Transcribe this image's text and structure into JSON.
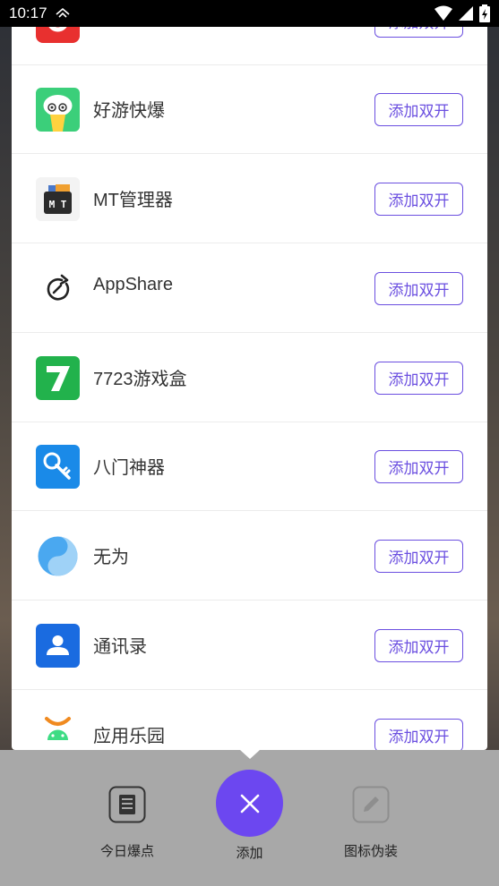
{
  "status_bar": {
    "time": "10:17"
  },
  "apps": [
    {
      "name": "",
      "button": "添加双开",
      "icon": "red-app-icon"
    },
    {
      "name": "好游快爆",
      "button": "添加双开",
      "icon": "haoyou-icon"
    },
    {
      "name": "MT管理器",
      "button": "添加双开",
      "icon": "mt-manager-icon"
    },
    {
      "name": "AppShare",
      "button": "添加双开",
      "icon": "appshare-icon"
    },
    {
      "name": "7723游戏盒",
      "button": "添加双开",
      "icon": "7723-icon"
    },
    {
      "name": "八门神器",
      "button": "添加双开",
      "icon": "bamen-icon"
    },
    {
      "name": "无为",
      "button": "添加双开",
      "icon": "wuwei-icon"
    },
    {
      "name": "通讯录",
      "button": "添加双开",
      "icon": "contacts-icon"
    },
    {
      "name": "应用乐园",
      "button": "添加双开",
      "icon": "android-icon"
    }
  ],
  "bottom_nav": {
    "left_label": "今日爆点",
    "center_label": "添加",
    "right_label": "图标伪装"
  },
  "colors": {
    "accent": "#6c47f0",
    "button_border": "#6b4fe0",
    "bottom_bar": "#a8a8a8"
  }
}
